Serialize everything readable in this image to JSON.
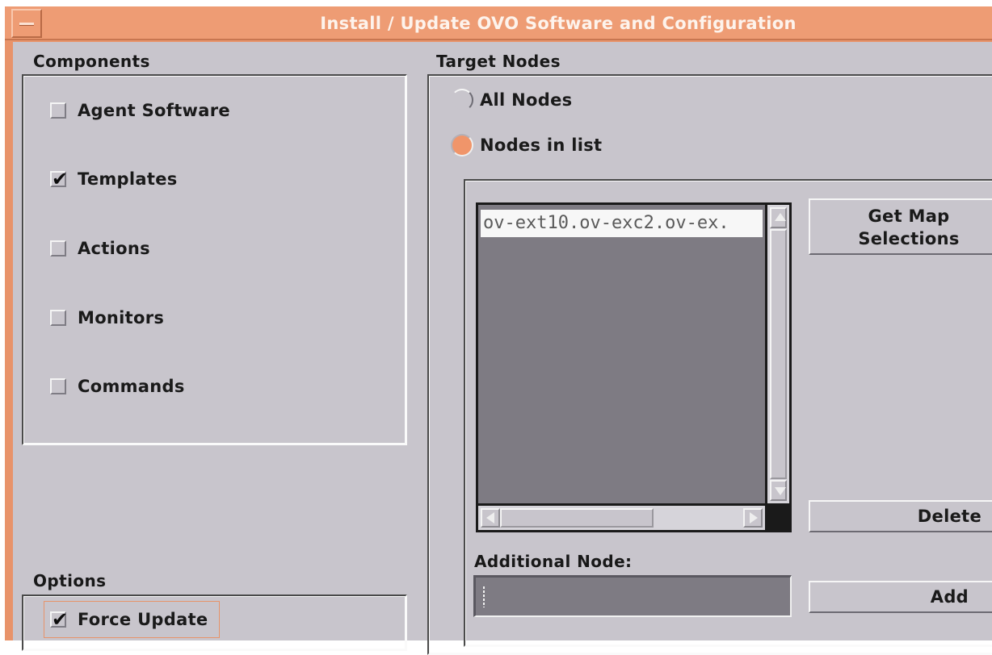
{
  "window": {
    "title": "Install / Update OVO Software and Configuration",
    "accent_color": "#ee9c74",
    "window_menu_icon": "window-menu-icon"
  },
  "components": {
    "label": "Components",
    "items": [
      {
        "label": "Agent Software",
        "checked": false
      },
      {
        "label": "Templates",
        "checked": true
      },
      {
        "label": "Actions",
        "checked": false
      },
      {
        "label": "Monitors",
        "checked": false
      },
      {
        "label": "Commands",
        "checked": false
      }
    ]
  },
  "options": {
    "label": "Options",
    "items": [
      {
        "label": "Force Update",
        "checked": true
      }
    ]
  },
  "target_nodes": {
    "label": "Target Nodes",
    "radios": [
      {
        "label": "All Nodes",
        "selected": false
      },
      {
        "label": "Nodes in list",
        "selected": true
      }
    ],
    "node_list": [
      "ov-ext10.ov-exc2.ov-ex."
    ],
    "buttons": {
      "get_map_line1": "Get Map",
      "get_map_line2": "Selections",
      "delete": "Delete",
      "add": "Add"
    },
    "additional_node_label": "Additional Node:",
    "additional_node_value": ""
  },
  "icons": {
    "check": "check-mark-icon",
    "scroll_up": "arrow-up-icon",
    "scroll_down": "arrow-down-icon",
    "scroll_left": "arrow-left-icon",
    "scroll_right": "arrow-right-icon"
  }
}
